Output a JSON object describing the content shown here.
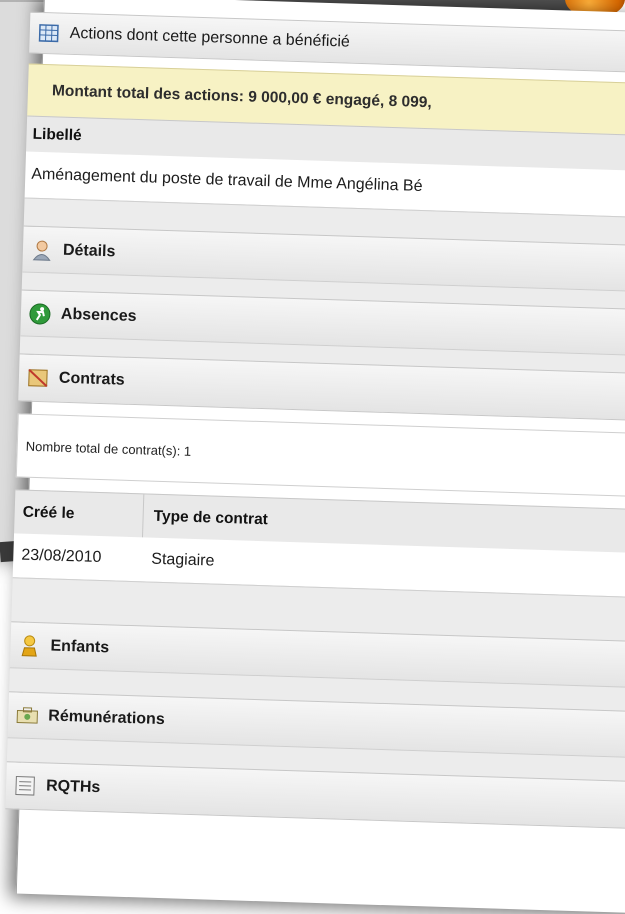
{
  "sections": {
    "actions": {
      "title": "Actions dont cette personne a bénéficié",
      "summary": "Montant total des actions: 9 000,00 € engagé, 8 099,",
      "column_libelle": "Libellé",
      "rows": [
        "Aménagement du poste de travail de Mme Angélina Bé"
      ]
    },
    "details": {
      "title": "Détails",
      "icon": "user-icon"
    },
    "absences": {
      "title": "Absences",
      "icon": "running-person-icon"
    },
    "contrats": {
      "title": "Contrats",
      "icon": "notebook-icon",
      "total": "Nombre total de contrat(s): 1",
      "columns": [
        "Créé le",
        "Type de contrat"
      ],
      "rows": [
        {
          "date": "23/08/2010",
          "type": "Stagiaire"
        }
      ]
    },
    "enfants": {
      "title": "Enfants",
      "icon": "child-icon"
    },
    "remunerations": {
      "title": "Rémunérations",
      "icon": "money-icon"
    },
    "rqths": {
      "title": "RQTHs",
      "icon": "list-icon"
    }
  },
  "colors": {
    "summary_bg": "#f7f2c4",
    "header_bg": "#e9e9e9",
    "accent_orange": "#e07a10"
  }
}
